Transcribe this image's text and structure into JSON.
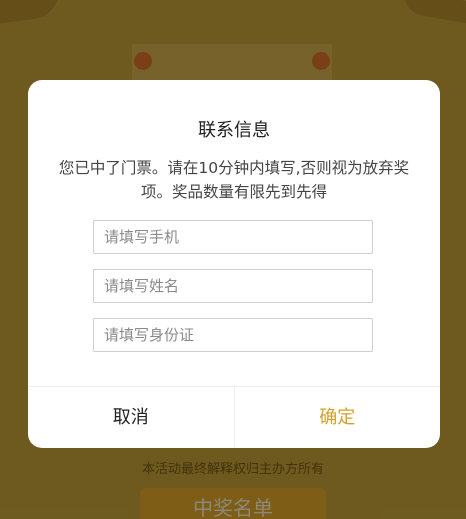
{
  "background": {
    "notice": "本活动最终解释权归主办方所有",
    "winner_list_button": "中奖名单"
  },
  "dialog": {
    "title": "联系信息",
    "message": "您已中了门票。请在10分钟内填写,否则视为放弃奖项。奖品数量有限先到先得",
    "fields": {
      "phone": {
        "placeholder": "请填写手机",
        "value": ""
      },
      "name": {
        "placeholder": "请填写姓名",
        "value": ""
      },
      "id_number": {
        "placeholder": "请填写身份证",
        "value": ""
      }
    },
    "buttons": {
      "cancel": "取消",
      "confirm": "确定"
    }
  },
  "colors": {
    "confirm_accent": "#d4a12a",
    "background": "#c9a53a"
  }
}
